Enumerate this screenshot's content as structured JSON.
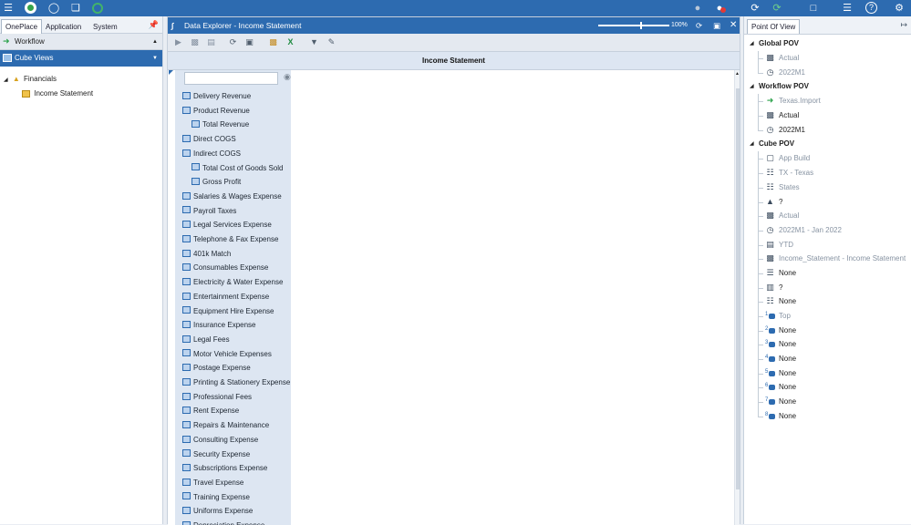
{
  "topbar": {
    "icons": [
      "menu-icon",
      "status-circle-icon",
      "globe-icon",
      "documents-icon",
      "refresh-circle-icon",
      "user-icon",
      "user-alert-icon",
      "sync-icon",
      "sync-green-icon",
      "clipboard-icon",
      "task-list-icon",
      "help-icon",
      "settings-grid-icon"
    ]
  },
  "left_panel": {
    "tabs": [
      "OnePlace",
      "Application",
      "System"
    ],
    "active_tab": "OnePlace",
    "workflow_label": "Workflow",
    "cube_views_label": "Cube Views",
    "tree": {
      "root": "Financials",
      "child": "Income Statement"
    }
  },
  "explorer": {
    "title": "Data Explorer - Income Statement",
    "zoom": "100%",
    "report_title": "Income Statement",
    "accounts": [
      {
        "label": "Delivery Revenue",
        "indent": 0
      },
      {
        "label": "Product Revenue",
        "indent": 0
      },
      {
        "label": "Total Revenue",
        "indent": 1
      },
      {
        "label": "Direct COGS",
        "indent": 0
      },
      {
        "label": "Indirect COGS",
        "indent": 0
      },
      {
        "label": "Total Cost of Goods Sold",
        "indent": 1
      },
      {
        "label": "Gross Profit",
        "indent": 1
      },
      {
        "label": "Salaries & Wages Expense",
        "indent": 0
      },
      {
        "label": "Payroll Taxes",
        "indent": 0
      },
      {
        "label": "Legal Services Expense",
        "indent": 0
      },
      {
        "label": "Telephone & Fax Expense",
        "indent": 0
      },
      {
        "label": "401k Match",
        "indent": 0
      },
      {
        "label": "Consumables Expense",
        "indent": 0
      },
      {
        "label": "Electricity & Water Expense",
        "indent": 0
      },
      {
        "label": "Entertainment Expense",
        "indent": 0
      },
      {
        "label": "Equipment Hire Expense",
        "indent": 0
      },
      {
        "label": "Insurance Expense",
        "indent": 0
      },
      {
        "label": "Legal Fees",
        "indent": 0
      },
      {
        "label": "Motor Vehicle Expenses",
        "indent": 0
      },
      {
        "label": "Postage Expense",
        "indent": 0
      },
      {
        "label": "Printing & Stationery Expense",
        "indent": 0
      },
      {
        "label": "Professional Fees",
        "indent": 0
      },
      {
        "label": "Rent Expense",
        "indent": 0
      },
      {
        "label": "Repairs & Maintenance",
        "indent": 0
      },
      {
        "label": "Consulting Expense",
        "indent": 0
      },
      {
        "label": "Security Expense",
        "indent": 0
      },
      {
        "label": "Subscriptions Expense",
        "indent": 0
      },
      {
        "label": "Travel Expense",
        "indent": 0
      },
      {
        "label": "Training Expense",
        "indent": 0
      },
      {
        "label": "Uniforms Expense",
        "indent": 0
      },
      {
        "label": "Depreciation Expense",
        "indent": 0
      }
    ]
  },
  "pov": {
    "tab": "Point Of View",
    "sections": [
      {
        "title": "Global POV",
        "items": [
          {
            "icon": "cube-dims-icon",
            "text": "Actual",
            "grey": true
          },
          {
            "icon": "clock-icon",
            "text": "2022M1",
            "grey": true
          }
        ]
      },
      {
        "title": "Workflow POV",
        "items": [
          {
            "icon": "arrow-right-icon",
            "text": "Texas.Import",
            "grey": true
          },
          {
            "icon": "cube-dims-icon",
            "text": "Actual",
            "grey": false
          },
          {
            "icon": "clock-icon",
            "text": "2022M1",
            "grey": false
          }
        ]
      },
      {
        "title": "Cube POV",
        "items": [
          {
            "icon": "cube-icon",
            "text": "App Build",
            "grey": true
          },
          {
            "icon": "hierarchy-icon",
            "text": "TX - Texas",
            "grey": true
          },
          {
            "icon": "hierarchy-icon",
            "text": "States",
            "grey": true
          },
          {
            "icon": "consolidation-icon",
            "text": "?",
            "grey": false
          },
          {
            "icon": "cube-dims-icon",
            "text": "Actual",
            "grey": true
          },
          {
            "icon": "clock-icon",
            "text": "2022M1 - Jan 2022",
            "grey": true
          },
          {
            "icon": "view-icon",
            "text": "YTD",
            "grey": true
          },
          {
            "icon": "account-icon",
            "text": "Income_Statement - Income Statement",
            "grey": true
          },
          {
            "icon": "flow-icon",
            "text": "None",
            "grey": false
          },
          {
            "icon": "origin-icon",
            "text": "?",
            "grey": false
          },
          {
            "icon": "ic-hierarchy-icon",
            "text": "None",
            "grey": false
          },
          {
            "icon": "ud1-icon",
            "text": "Top",
            "grey": true
          },
          {
            "icon": "ud2-icon",
            "text": "None",
            "grey": false
          },
          {
            "icon": "ud3-icon",
            "text": "None",
            "grey": false
          },
          {
            "icon": "ud4-icon",
            "text": "None",
            "grey": false
          },
          {
            "icon": "ud5-icon",
            "text": "None",
            "grey": false
          },
          {
            "icon": "ud6-icon",
            "text": "None",
            "grey": false
          },
          {
            "icon": "ud7-icon",
            "text": "None",
            "grey": false
          },
          {
            "icon": "ud8-icon",
            "text": "None",
            "grey": false
          }
        ]
      }
    ]
  },
  "colors": {
    "brand": "#2d6bb0",
    "row_header": "#dde6f2",
    "member_icon": "#2d6bb0",
    "green_arrow": "#2aa14a"
  }
}
